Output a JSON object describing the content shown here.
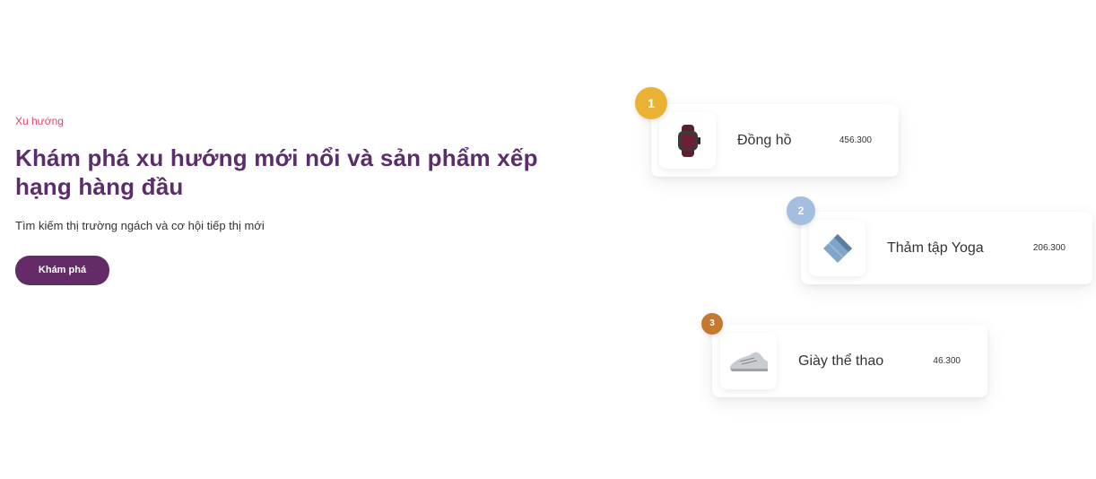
{
  "hero": {
    "eyebrow": "Xu hướng",
    "title": "Khám phá xu hướng mới nổi và sản phẩm xếp hạng hàng đầu",
    "subtitle": "Tìm kiếm thị trường ngách và cơ hội tiếp thị mới",
    "button_label": "Khám phá"
  },
  "ranking": {
    "items": [
      {
        "rank": "1",
        "name": "Đồng hồ",
        "price": "456.300",
        "icon": "smartwatch-icon",
        "badge_color": "#e9b234"
      },
      {
        "rank": "2",
        "name": "Thảm tập Yoga",
        "price": "206.300",
        "icon": "yoga-mat-icon",
        "badge_color": "#a4bedf"
      },
      {
        "rank": "3",
        "name": "Giày thể thao",
        "price": "46.300",
        "icon": "sneaker-icon",
        "badge_color": "#c37a2f"
      }
    ]
  },
  "colors": {
    "accent": "#652b68",
    "eyebrow": "#e0446a"
  }
}
